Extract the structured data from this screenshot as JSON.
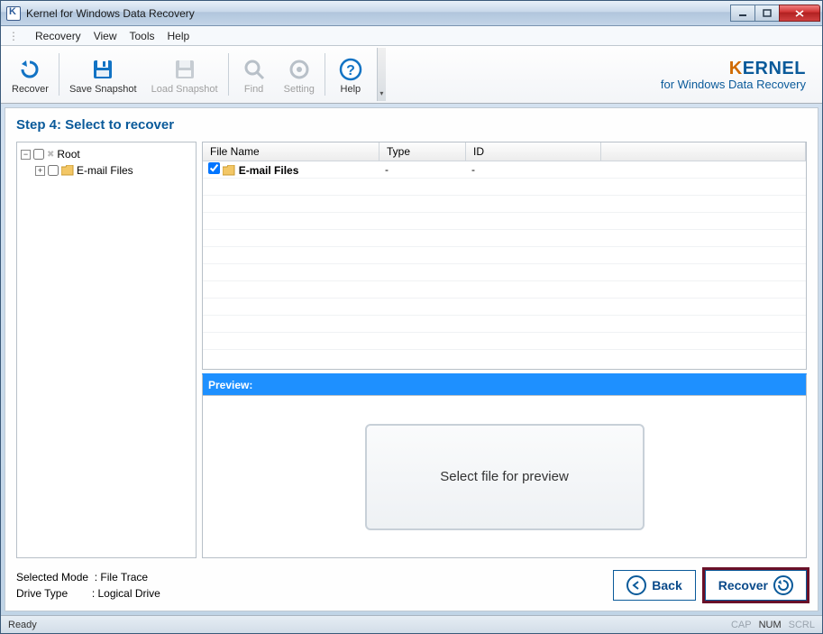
{
  "window": {
    "title": "Kernel for Windows Data Recovery"
  },
  "menu": {
    "items": [
      "Recovery",
      "View",
      "Tools",
      "Help"
    ]
  },
  "toolbar": {
    "recover": "Recover",
    "save_snapshot": "Save Snapshot",
    "load_snapshot": "Load Snapshot",
    "find": "Find",
    "setting": "Setting",
    "help": "Help"
  },
  "brand": {
    "name_k": "K",
    "name_rest": "ERNEL",
    "sub": "for Windows Data Recovery"
  },
  "step": {
    "title": "Step 4: Select to recover"
  },
  "tree": {
    "root": "Root",
    "child": "E-mail Files"
  },
  "grid": {
    "headers": {
      "name": "File Name",
      "type": "Type",
      "id": "ID"
    },
    "rows": [
      {
        "name": "E-mail Files",
        "type": "-",
        "id": "-"
      }
    ]
  },
  "preview": {
    "header": "Preview:",
    "empty": "Select file for preview"
  },
  "footer": {
    "mode_label": "Selected Mode",
    "mode_value": "File Trace",
    "drive_label": "Drive Type",
    "drive_value": "Logical Drive",
    "back": "Back",
    "recover": "Recover"
  },
  "status": {
    "ready": "Ready",
    "cap": "CAP",
    "num": "NUM",
    "scrl": "SCRL"
  }
}
